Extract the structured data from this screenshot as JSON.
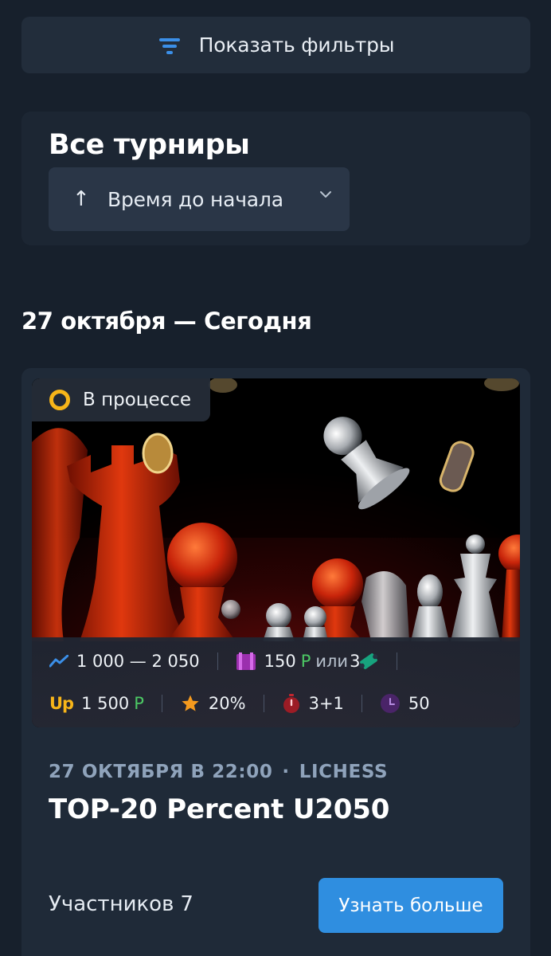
{
  "filters": {
    "label": "Показать фильтры",
    "icon": "filter-icon"
  },
  "sort": {
    "title": "Все турниры",
    "direction_icon": "arrow-up-icon",
    "value": "Время до начала",
    "chevron_icon": "chevron-down-icon"
  },
  "date_heading": "27 октября — Сегодня",
  "card": {
    "status": "В процессе",
    "stats": {
      "rating_range": "1 000 — 2 050",
      "fee_amount": "150",
      "fee_currency": "Р",
      "fee_or": "или",
      "fee_tickets": "3",
      "up_label": "Up",
      "prize_amount": "1 500",
      "prize_currency": "Р",
      "percent": "20%",
      "time_control": "3+1",
      "rounds": "50"
    },
    "date": "27 ОКТЯБРЯ В 22:00",
    "dot": "·",
    "platform": "LICHESS",
    "title": "TOP-20 Percent U2050",
    "participants_label": "Участников",
    "participants_count": "7",
    "button_label": "Узнать больше"
  },
  "colors": {
    "background": "#17202c",
    "panel": "#222d3b",
    "accent_blue": "#2f8ee0",
    "status_yellow": "#f7b519",
    "ruble_green": "#4cc864"
  }
}
